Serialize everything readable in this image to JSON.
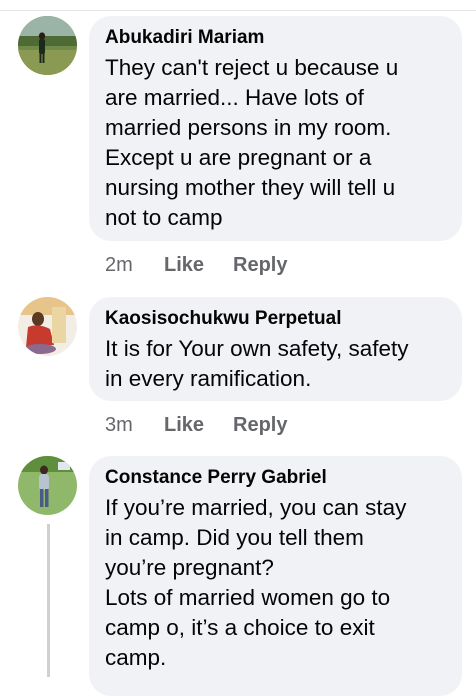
{
  "comments": [
    {
      "author": "Abukadiri Mariam",
      "text": "They can't reject u because u\nare married... Have lots of\nmarried persons in my room.\nExcept u are pregnant or a\nnursing mother they will tell u\nnot to camp",
      "time": "2m",
      "like_label": "Like",
      "reply_label": "Reply",
      "avatar_icon": "profile-photo-outdoor"
    },
    {
      "author": "Kaosisochukwu Perpetual",
      "text": "It is for Your own safety, safety\nin every ramification.",
      "time": "3m",
      "like_label": "Like",
      "reply_label": "Reply",
      "avatar_icon": "profile-photo-red-outfit"
    },
    {
      "author": "Constance Perry Gabriel",
      "text": "If you’re married, you can stay\nin camp. Did you tell them\nyou’re pregnant?\nLots of married women go to\ncamp o, it’s a choice to exit\ncamp.",
      "avatar_icon": "profile-photo-standing-green"
    }
  ],
  "colors": {
    "bubble": "#f0f2f5",
    "meta_text": "#65676b",
    "body_text": "#050505",
    "thread_line": "#ced0d4"
  }
}
